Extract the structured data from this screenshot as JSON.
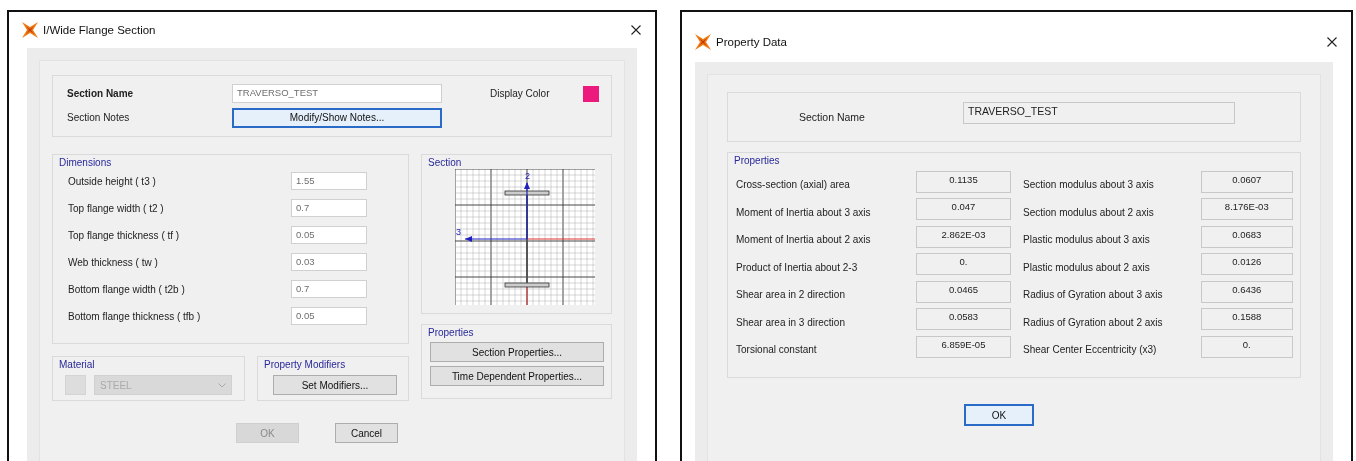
{
  "section_dialog": {
    "title": "I/Wide Flange Section",
    "header": {
      "name_label": "Section Name",
      "name_value": "TRAVERSO_TEST",
      "notes_label": "Section Notes",
      "notes_button": {
        "label": "Modify/Show Notes...",
        "focused": true
      },
      "display_color": {
        "label": "Display Color",
        "color": "#ec1a7c"
      }
    },
    "dimensions": {
      "title": "Dimensions",
      "rows": [
        {
          "label": "Outside height  ( t3 )",
          "value": "1.55"
        },
        {
          "label": "Top flange width  ( t2 )",
          "value": "0.7"
        },
        {
          "label": "Top flange thickness  ( tf )",
          "value": "0.05"
        },
        {
          "label": "Web thickness  ( tw )",
          "value": "0.03"
        },
        {
          "label": "Bottom flange width  ( t2b )",
          "value": "0.7"
        },
        {
          "label": "Bottom flange thickness  ( tfb )",
          "value": "0.05"
        }
      ]
    },
    "section": {
      "title": "Section",
      "axis_vertical": "2",
      "axis_horizontal": "3"
    },
    "properties": {
      "title": "Properties",
      "buttons": [
        "Section Properties...",
        "Time Dependent Properties..."
      ]
    },
    "material": {
      "title": "Material",
      "value": "STEEL",
      "disabled": true
    },
    "property_modifiers": {
      "title": "Property Modifiers",
      "button": "Set Modifiers..."
    },
    "buttons": [
      {
        "label": "OK",
        "disabled": true
      },
      {
        "label": "Cancel",
        "disabled": false
      }
    ]
  },
  "property_dialog": {
    "title": "Property Data",
    "name_label": "Section Name",
    "name_value": "TRAVERSO_TEST",
    "properties": {
      "title": "Properties",
      "items": [
        {
          "label": "Cross-section (axial) area",
          "value": "0.1135"
        },
        {
          "label": "Moment of Inertia about 3 axis",
          "value": "0.047"
        },
        {
          "label": "Moment of Inertia about 2 axis",
          "value": "2.862E-03"
        },
        {
          "label": "Product of Inertia about 2-3",
          "value": "0."
        },
        {
          "label": "Shear area in 2 direction",
          "value": "0.0465"
        },
        {
          "label": "Shear area in 3 direction",
          "value": "0.0583"
        },
        {
          "label": "Torsional constant",
          "value": "6.859E-05"
        },
        {
          "label": "Section modulus about 3 axis",
          "value": "0.0607"
        },
        {
          "label": "Section modulus about 2 axis",
          "value": "8.176E-03"
        },
        {
          "label": "Plastic modulus about 3 axis",
          "value": "0.0683"
        },
        {
          "label": "Plastic modulus about 2 axis",
          "value": "0.0126"
        },
        {
          "label": "Radius of Gyration about 3 axis",
          "value": "0.6436"
        },
        {
          "label": "Radius of Gyration about 2 axis",
          "value": "0.1588"
        },
        {
          "label": "Shear Center Eccentricity (x3)",
          "value": "0."
        }
      ]
    },
    "ok_button": {
      "label": "OK",
      "focused": true
    }
  }
}
